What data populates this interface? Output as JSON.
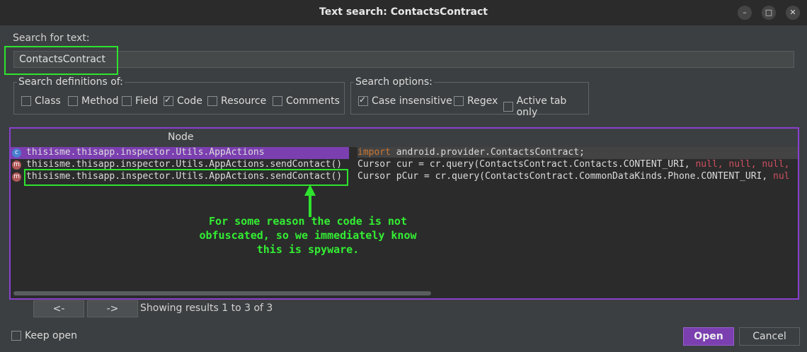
{
  "window": {
    "title": "Text search: ContactsContract",
    "minimize": "–",
    "maximize": "□",
    "close": "✕"
  },
  "search": {
    "label": "Search for text:",
    "value": "ContactsContract"
  },
  "definitions": {
    "label": "Search definitions of:",
    "items": [
      {
        "label": "Class",
        "checked": false
      },
      {
        "label": "Method",
        "checked": false
      },
      {
        "label": "Field",
        "checked": false
      },
      {
        "label": "Code",
        "checked": true
      },
      {
        "label": "Resource",
        "checked": false
      },
      {
        "label": "Comments",
        "checked": false
      }
    ]
  },
  "options": {
    "label": "Search options:",
    "items": [
      {
        "label": "Case insensitive",
        "checked": true
      },
      {
        "label": "Regex",
        "checked": false
      },
      {
        "label": "Active tab only",
        "checked": false
      }
    ]
  },
  "results": {
    "column_node": "Node",
    "rows": [
      {
        "icon": "c",
        "node": "thisisme.thisapp.inspector.Utils.AppActions",
        "code_kw": "import",
        "code": " android.provider.ContactsContract;"
      },
      {
        "icon": "m",
        "node": "thisisme.thisapp.inspector.Utils.AppActions.sendContact()",
        "code": "Cursor cur = cr.query(ContactsContract.Contacts.CONTENT_URI, ",
        "nulls": "null, null, null,"
      },
      {
        "icon": "m",
        "node": "thisisme.thisapp.inspector.Utils.AppActions.sendContact()",
        "code": "Cursor pCur = cr.query(ContactsContract.CommonDataKinds.Phone.CONTENT_URI, ",
        "nulls": "nul"
      }
    ]
  },
  "annotation": [
    "For some reason the code is not",
    "obfuscated, so we immediately know",
    "this is spyware."
  ],
  "pager": {
    "prev": "<-",
    "next": "->",
    "status": "Showing results 1 to 3 of 3"
  },
  "footer": {
    "keep_open": "Keep open",
    "open": "Open",
    "cancel": "Cancel"
  },
  "colors": {
    "highlight": "#2ee32e",
    "selection": "#8a3fcf",
    "open_button": "#7b3fb0"
  }
}
